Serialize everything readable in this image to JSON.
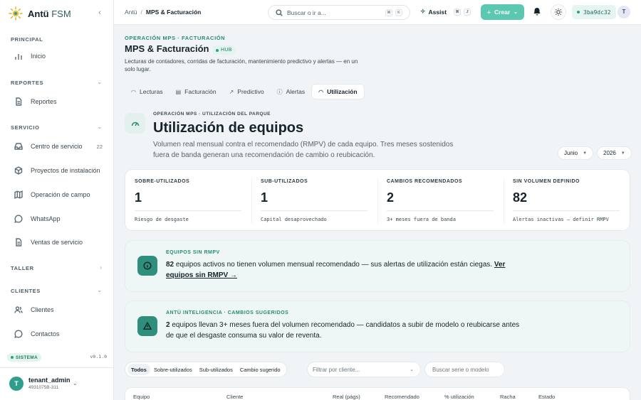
{
  "brand": {
    "name_bold": "Antü",
    "name_light": "FSM",
    "collapse_glyph": "‹"
  },
  "sidebar": {
    "sections": [
      {
        "label": "PRINCIPAL",
        "chevron": ""
      },
      {
        "label": "REPORTES",
        "chevron": "⌄"
      },
      {
        "label": "SERVICIO",
        "chevron": "⌄"
      },
      {
        "label": "TALLER",
        "chevron": "›"
      },
      {
        "label": "CLIENTES",
        "chevron": "⌄"
      }
    ],
    "items": [
      {
        "label": "Inicio",
        "icon": "bar-chart-icon",
        "count": ""
      },
      {
        "label": "Reportes",
        "icon": "document-icon",
        "count": ""
      },
      {
        "label": "Centro de servicio",
        "icon": "inbox-icon",
        "count": "22"
      },
      {
        "label": "Proyectos de instalación",
        "icon": "box-icon",
        "count": ""
      },
      {
        "label": "Operación de campo",
        "icon": "map-icon",
        "count": ""
      },
      {
        "label": "WhatsApp",
        "icon": "chat-icon",
        "count": ""
      },
      {
        "label": "Ventas de servicio",
        "icon": "document-icon",
        "count": ""
      },
      {
        "label": "Clientes",
        "icon": "users-icon",
        "count": ""
      },
      {
        "label": "Contactos",
        "icon": "chat-icon",
        "count": ""
      }
    ],
    "system": {
      "badge": "SISTEMA",
      "version": "v0.1.0"
    },
    "user": {
      "initial": "T",
      "name": "tenant_admin",
      "id": "4931075B-311"
    }
  },
  "topbar": {
    "breadcrumb_root": "Antü",
    "breadcrumb_sep": "/",
    "breadcrumb_current": "MPS & Facturación",
    "search_placeholder": "Buscar o ir a...",
    "search_keys": [
      "⌘",
      "K"
    ],
    "assist_label": "Assist",
    "assist_keys": [
      "⌘",
      "J"
    ],
    "create_label": "Crear",
    "commit": "3ba9dc32",
    "avatar_initial": "T"
  },
  "header": {
    "eyebrow": "OPERACIÓN MPS · FACTURACIÓN",
    "title": "MPS & Facturación",
    "badge": "HUB",
    "description": "Lecturas de contadores, corridas de facturación, mantenimiento predictivo y alertas — en un solo lugar."
  },
  "tabs": [
    {
      "label": "Lecturas",
      "icon": "gauge-icon"
    },
    {
      "label": "Facturación",
      "icon": "document-icon"
    },
    {
      "label": "Predictivo",
      "icon": "trend-icon"
    },
    {
      "label": "Alertas",
      "icon": "alert-icon"
    },
    {
      "label": "Utilización",
      "icon": "gauge-icon"
    }
  ],
  "utilization": {
    "eyebrow": "OPERACIÓN MPS · UTILIZACIÓN DEL PARQUE",
    "title": "Utilización de equipos",
    "description": "Volumen real mensual contra el recomendado (RMPV) de cada equipo. Tres meses sostenidos fuera de banda generan una recomendación de cambio o reubicación.",
    "month": "Junio",
    "year": "2026"
  },
  "stats": [
    {
      "label": "SOBRE-UTILIZADOS",
      "value": "1",
      "sub": "Riesgo de desgaste"
    },
    {
      "label": "SUB-UTILIZADOS",
      "value": "1",
      "sub": "Capital desaprovechado"
    },
    {
      "label": "CAMBIOS RECOMENDADOS",
      "value": "2",
      "sub": "3+ meses fuera de banda"
    },
    {
      "label": "SIN VOLUMEN DEFINIDO",
      "value": "82",
      "sub": "Alertas inactivas — definir RMPV"
    }
  ],
  "alert_rmpv": {
    "eyebrow": "EQUIPOS SIN RMPV",
    "count": "82",
    "text": " equipos activos no tienen volumen mensual recomendado — sus alertas de utilización están ciegas. ",
    "link": "Ver equipos sin RMPV →"
  },
  "alert_ai": {
    "eyebrow": "ANTÜ INTELIGENCIA · CAMBIOS SUGERIDOS",
    "count": "2",
    "text": " equipos llevan 3+ meses fuera del volumen recomendado — candidatos a subir de modelo o reubicarse antes de que el desgaste consuma su valor de reventa."
  },
  "filters": {
    "chips": [
      "Todos",
      "Sobre-utilizados",
      "Sub-utilizados",
      "Cambio sugerido"
    ],
    "client_placeholder": "Filtrar por cliente...",
    "serie_placeholder": "Buscar serie o modelo"
  },
  "table": {
    "columns": [
      "Equipo",
      "Cliente",
      "Real (págs)",
      "Recomendado",
      "% utilización",
      "Racha",
      "Estado"
    ]
  },
  "colors": {
    "accent": "#2a8a74",
    "create": "#5cc8b2",
    "alert_icon": "#2f8f7c"
  }
}
